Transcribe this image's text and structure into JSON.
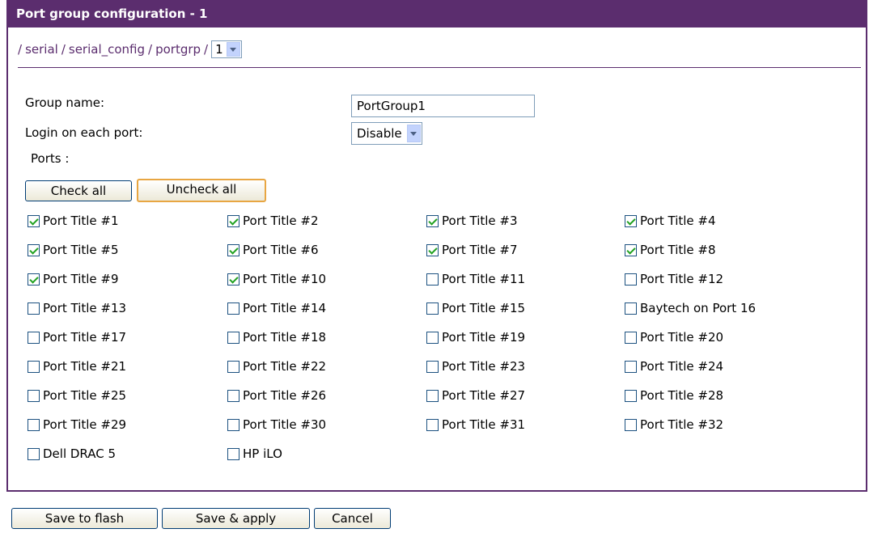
{
  "title": "Port group configuration - 1",
  "breadcrumb": {
    "items": [
      "serial",
      "serial_config",
      "portgrp"
    ],
    "sep": "/",
    "selected": "1"
  },
  "form": {
    "group_name_label": "Group name:",
    "group_name_value": "PortGroup1",
    "login_label": "Login on each port:",
    "login_value": "Disable",
    "ports_label": "Ports :"
  },
  "buttons": {
    "check_all": "Check all",
    "uncheck_all": "Uncheck all",
    "save_flash": "Save to flash",
    "save_apply": "Save & apply",
    "cancel": "Cancel"
  },
  "ports": [
    {
      "label": "Port Title #1",
      "checked": true
    },
    {
      "label": "Port Title #2",
      "checked": true
    },
    {
      "label": "Port Title #3",
      "checked": true
    },
    {
      "label": "Port Title #4",
      "checked": true
    },
    {
      "label": "Port Title #5",
      "checked": true
    },
    {
      "label": "Port Title #6",
      "checked": true
    },
    {
      "label": "Port Title #7",
      "checked": true
    },
    {
      "label": "Port Title #8",
      "checked": true
    },
    {
      "label": "Port Title #9",
      "checked": true
    },
    {
      "label": "Port Title #10",
      "checked": true
    },
    {
      "label": "Port Title #11",
      "checked": false
    },
    {
      "label": "Port Title #12",
      "checked": false
    },
    {
      "label": "Port Title #13",
      "checked": false
    },
    {
      "label": "Port Title #14",
      "checked": false
    },
    {
      "label": "Port Title #15",
      "checked": false
    },
    {
      "label": "Baytech on Port 16",
      "checked": false
    },
    {
      "label": "Port Title #17",
      "checked": false
    },
    {
      "label": "Port Title #18",
      "checked": false
    },
    {
      "label": "Port Title #19",
      "checked": false
    },
    {
      "label": "Port Title #20",
      "checked": false
    },
    {
      "label": "Port Title #21",
      "checked": false
    },
    {
      "label": "Port Title #22",
      "checked": false
    },
    {
      "label": "Port Title #23",
      "checked": false
    },
    {
      "label": "Port Title #24",
      "checked": false
    },
    {
      "label": "Port Title #25",
      "checked": false
    },
    {
      "label": "Port Title #26",
      "checked": false
    },
    {
      "label": "Port Title #27",
      "checked": false
    },
    {
      "label": "Port Title #28",
      "checked": false
    },
    {
      "label": "Port Title #29",
      "checked": false
    },
    {
      "label": "Port Title #30",
      "checked": false
    },
    {
      "label": "Port Title #31",
      "checked": false
    },
    {
      "label": "Port Title #32",
      "checked": false
    },
    {
      "label": "Dell DRAC 5",
      "checked": false
    },
    {
      "label": "HP iLO",
      "checked": false
    }
  ]
}
